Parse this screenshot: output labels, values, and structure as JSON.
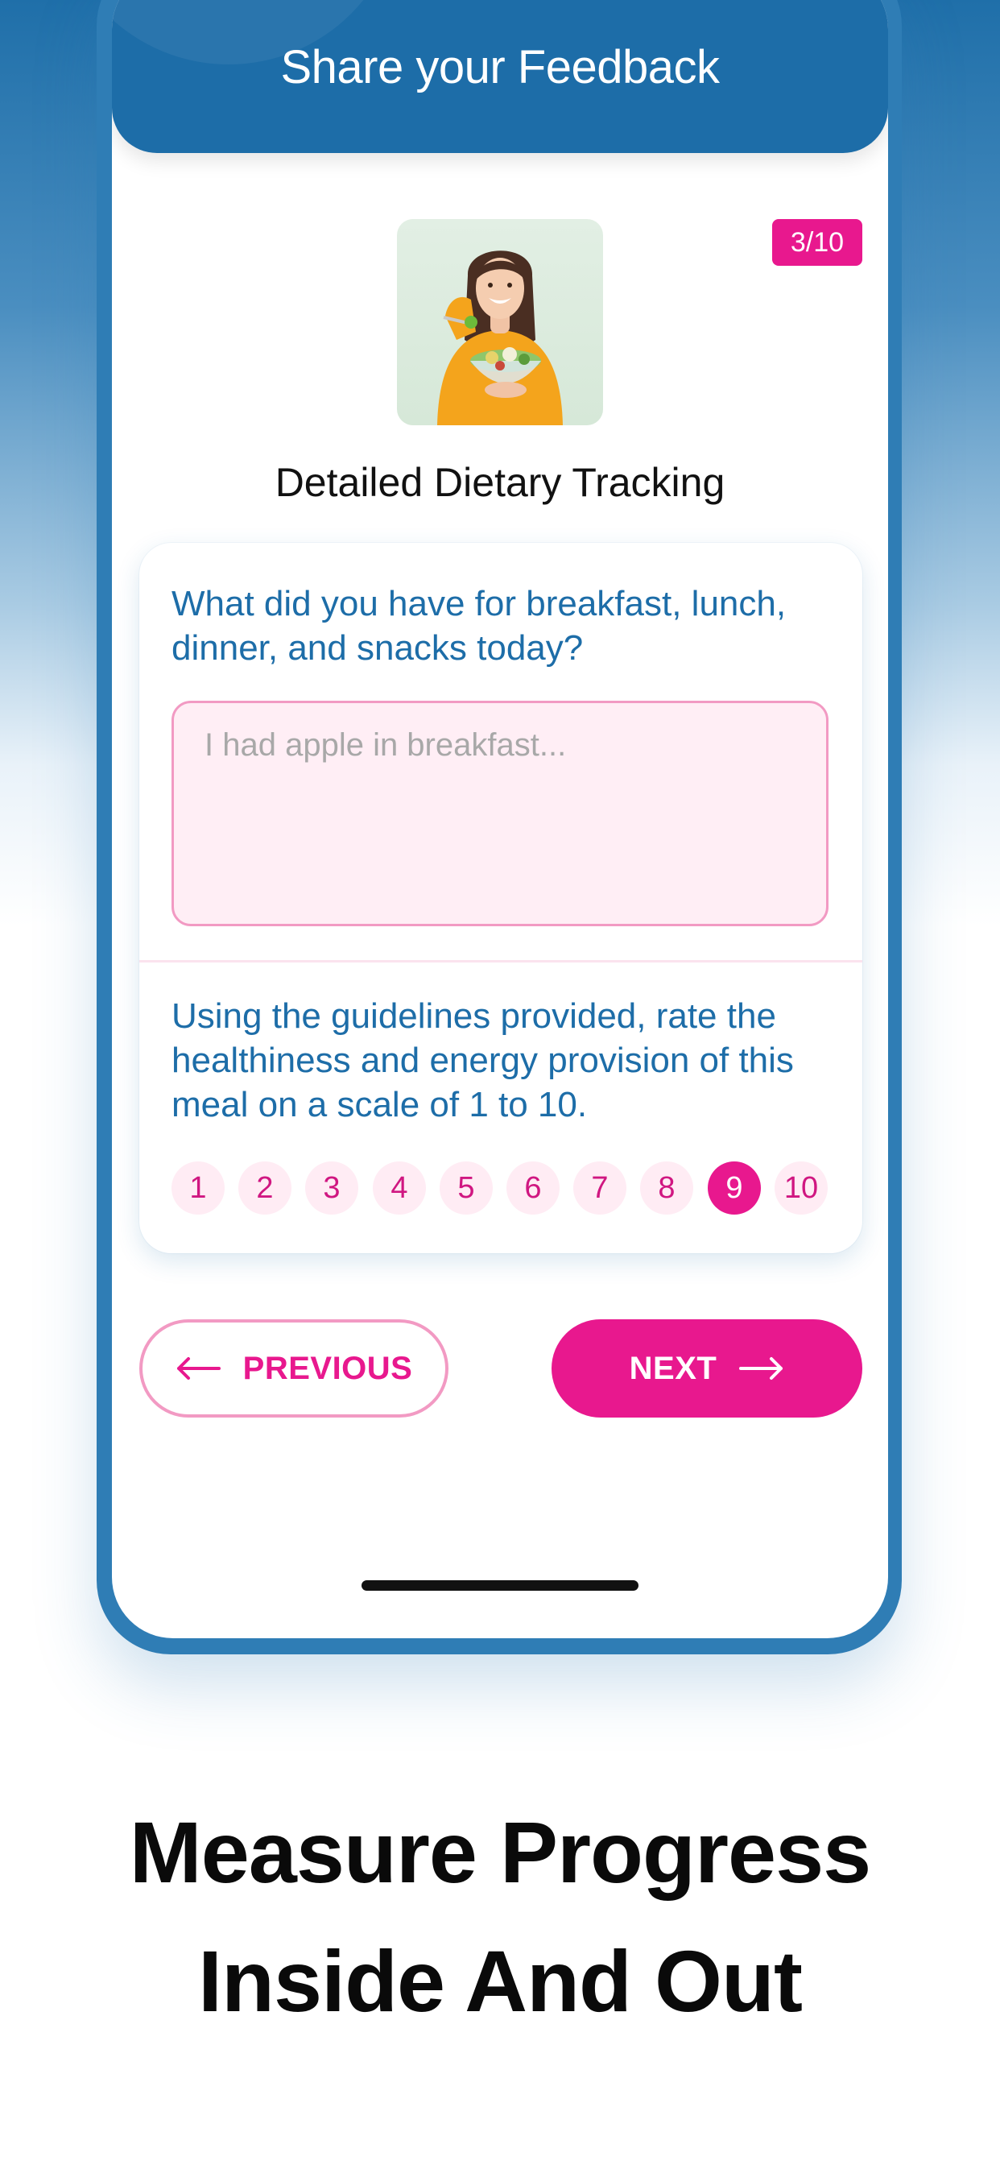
{
  "header": {
    "title": "Share your Feedback"
  },
  "progress": {
    "label": "3/10",
    "current": 3,
    "total": 10
  },
  "section": {
    "title": "Detailed Dietary Tracking"
  },
  "question1": {
    "text": "What did you have for breakfast, lunch, dinner, and snacks today?",
    "placeholder": "I had apple in breakfast...",
    "value": ""
  },
  "question2": {
    "text": "Using the guidelines provided, rate the healthiness and energy provision of this meal on a scale of 1 to 10.",
    "options": [
      "1",
      "2",
      "3",
      "4",
      "5",
      "6",
      "7",
      "8",
      "9",
      "10"
    ],
    "selected": "9"
  },
  "nav": {
    "previous_label": "PREVIOUS",
    "next_label": "NEXT"
  },
  "tagline": {
    "line1": "Measure Progress",
    "line2": "Inside And Out"
  },
  "colors": {
    "brand_blue": "#1d6da8",
    "accent_pink": "#e8188e",
    "field_bg": "#ffeef5"
  },
  "icons": {
    "previous": "arrow-left-icon",
    "next": "arrow-right-icon"
  }
}
